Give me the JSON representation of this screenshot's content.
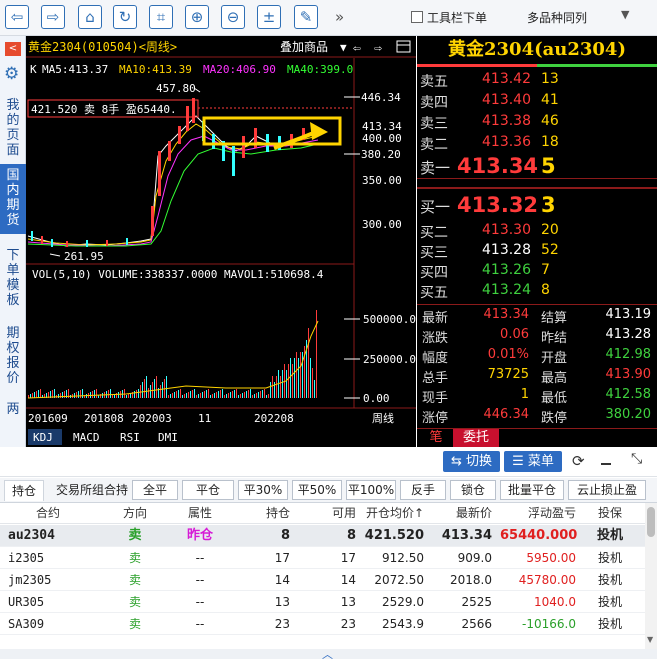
{
  "toolbar": {
    "toolbar_checkbox_label": "工具栏下单",
    "multi_label": "多品种同列",
    "more_glyph": "»"
  },
  "sidebar": {
    "items": [
      "我的页面",
      "国内期货",
      "下单模板",
      "期权报价",
      "两"
    ]
  },
  "chart": {
    "header_title": "黄金2304(010504)<周线>",
    "overlay_label": "叠加商品",
    "ma_line": {
      "k_label": "K",
      "ma5": "MA5:413.37",
      "ma10": "MA10:413.39",
      "ma20": "MA20:406.90",
      "ma40": "MA40:399.0"
    },
    "price_axis": [
      "446.34",
      "413.34",
      "400.00",
      "380.20",
      "350.00",
      "300.00"
    ],
    "high_label": "457.80",
    "low_label": "261.95",
    "position_tag": "421.520 卖 8手 盈65440.",
    "volume_line": "VOL(5,10) VOLUME:338337.0000 MAVOL1:510698.4",
    "volume_axis": [
      "500000.00",
      "250000.00",
      "0.00"
    ],
    "date_axis": [
      "201609",
      "201808",
      "202003",
      "11",
      "202208"
    ],
    "period_label": "周线",
    "indicator_tabs": [
      "KDJ",
      "MACD",
      "RSI",
      "DMI"
    ],
    "colors": {
      "ma5": "#ffffff",
      "ma10": "#ffd400",
      "ma20": "#ff33ff",
      "ma40": "#33ff33"
    }
  },
  "quote": {
    "title": "黄金2304(au2304)",
    "asks": [
      {
        "label": "卖五",
        "price": "413.42",
        "vol": "13"
      },
      {
        "label": "卖四",
        "price": "413.40",
        "vol": "41"
      },
      {
        "label": "卖三",
        "price": "413.38",
        "vol": "46"
      },
      {
        "label": "卖二",
        "price": "413.36",
        "vol": "18"
      }
    ],
    "ask1": {
      "label": "卖一",
      "price": "413.34",
      "vol": "5"
    },
    "bid1": {
      "label": "买一",
      "price": "413.32",
      "vol": "3"
    },
    "bids": [
      {
        "label": "买二",
        "price": "413.30",
        "vol": "20"
      },
      {
        "label": "买三",
        "price": "413.28",
        "vol": "52"
      },
      {
        "label": "买四",
        "price": "413.26",
        "vol": "7"
      },
      {
        "label": "买五",
        "price": "413.24",
        "vol": "8"
      }
    ],
    "stats": [
      {
        "l1": "最新",
        "v1": "413.34",
        "c1": "red",
        "l2": "结算",
        "v2": "413.19",
        "c2": "white"
      },
      {
        "l1": "涨跌",
        "v1": "0.06",
        "c1": "red",
        "l2": "昨结",
        "v2": "413.28",
        "c2": "white"
      },
      {
        "l1": "幅度",
        "v1": "0.01%",
        "c1": "red",
        "l2": "开盘",
        "v2": "412.98",
        "c2": "green"
      },
      {
        "l1": "总手",
        "v1": "73725",
        "c1": "yellow",
        "l2": "最高",
        "v2": "413.90",
        "c2": "red"
      },
      {
        "l1": "现手",
        "v1": "1",
        "c1": "yellow",
        "l2": "最低",
        "v2": "412.58",
        "c2": "green"
      },
      {
        "l1": "涨停",
        "v1": "446.34",
        "c1": "red",
        "l2": "跌停",
        "v2": "380.20",
        "c2": "green"
      }
    ],
    "tab_bi": "笔",
    "tab_order": "委托"
  },
  "midbar": {
    "switch_label": "⇆ 切换",
    "menu_label": "☰ 菜单"
  },
  "tabs": {
    "positions": "持仓",
    "combo": "交易所组合持",
    "actions": [
      "全平",
      "平仓",
      "平30%",
      "平50%",
      "平100%",
      "反手",
      "锁仓",
      "批量平仓",
      "云止损止盈"
    ]
  },
  "table": {
    "headers": [
      "合约",
      "方向",
      "属性",
      "持仓",
      "可用",
      "开仓均价↑",
      "最新价",
      "浮动盈亏",
      "投保"
    ],
    "rows": [
      [
        "au2304",
        "卖",
        "昨仓",
        "8",
        "8",
        "421.520",
        "413.34",
        "65440.000",
        "投机"
      ],
      [
        "i2305",
        "卖",
        "--",
        "17",
        "17",
        "912.50",
        "909.0",
        "5950.00",
        "投机"
      ],
      [
        "jm2305",
        "卖",
        "--",
        "14",
        "14",
        "2072.50",
        "2018.0",
        "45780.00",
        "投机"
      ],
      [
        "UR305",
        "卖",
        "--",
        "13",
        "13",
        "2529.0",
        "2525",
        "1040.0",
        "投机"
      ],
      [
        "SA309",
        "卖",
        "--",
        "23",
        "23",
        "2543.9",
        "2566",
        "-10166.0",
        "投机"
      ]
    ]
  }
}
